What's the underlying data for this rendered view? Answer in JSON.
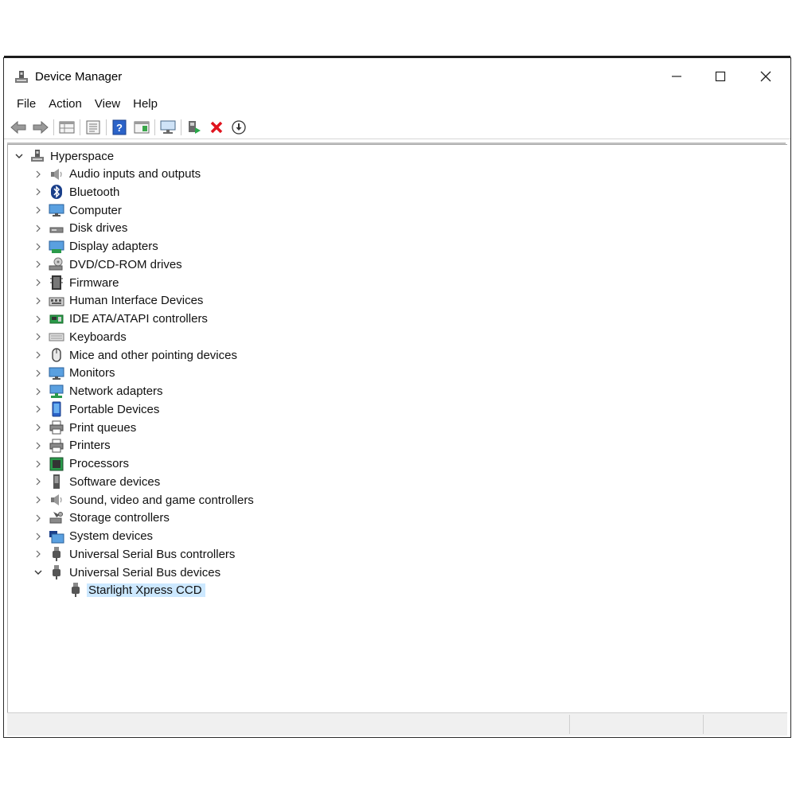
{
  "window": {
    "title": "Device Manager",
    "minimize_glyph": "—",
    "maximize_glyph": "☐",
    "close_glyph": "✕"
  },
  "menu": [
    "File",
    "Action",
    "View",
    "Help"
  ],
  "toolbar": {
    "buttons": [
      "back-icon",
      "forward-icon",
      "properties-grid-icon",
      "view-list-icon",
      "help-icon",
      "action-pane-icon",
      "scan-hardware-icon",
      "update-driver-icon",
      "uninstall-icon",
      "disable-icon"
    ]
  },
  "tree": {
    "root": "Hyperspace",
    "categories": [
      {
        "label": "Audio inputs and outputs",
        "icon": "speaker-icon"
      },
      {
        "label": "Bluetooth",
        "icon": "bluetooth-icon"
      },
      {
        "label": "Computer",
        "icon": "monitor-icon"
      },
      {
        "label": "Disk drives",
        "icon": "disk-drive-icon"
      },
      {
        "label": "Display adapters",
        "icon": "display-adapter-icon"
      },
      {
        "label": "DVD/CD-ROM drives",
        "icon": "dvd-drive-icon"
      },
      {
        "label": "Firmware",
        "icon": "firmware-icon"
      },
      {
        "label": "Human Interface Devices",
        "icon": "hid-icon"
      },
      {
        "label": "IDE ATA/ATAPI controllers",
        "icon": "ide-controller-icon"
      },
      {
        "label": "Keyboards",
        "icon": "keyboard-icon"
      },
      {
        "label": "Mice and other pointing devices",
        "icon": "mouse-icon"
      },
      {
        "label": "Monitors",
        "icon": "monitor-icon"
      },
      {
        "label": "Network adapters",
        "icon": "network-adapter-icon"
      },
      {
        "label": "Portable Devices",
        "icon": "portable-device-icon"
      },
      {
        "label": "Print queues",
        "icon": "printer-icon"
      },
      {
        "label": "Printers",
        "icon": "printer-icon"
      },
      {
        "label": "Processors",
        "icon": "processor-icon"
      },
      {
        "label": "Software devices",
        "icon": "software-device-icon"
      },
      {
        "label": "Sound, video and game controllers",
        "icon": "speaker-icon"
      },
      {
        "label": "Storage controllers",
        "icon": "storage-controller-icon"
      },
      {
        "label": "System devices",
        "icon": "system-devices-icon"
      },
      {
        "label": "Universal Serial Bus controllers",
        "icon": "usb-icon"
      },
      {
        "label": "Universal Serial Bus devices",
        "icon": "usb-icon"
      }
    ],
    "expanded_child": "Starlight Xpress CCD"
  },
  "colors": {
    "selection": "#cce8ff",
    "accent_blue": "#1e73d8",
    "uninstall_red": "#e0141e"
  }
}
